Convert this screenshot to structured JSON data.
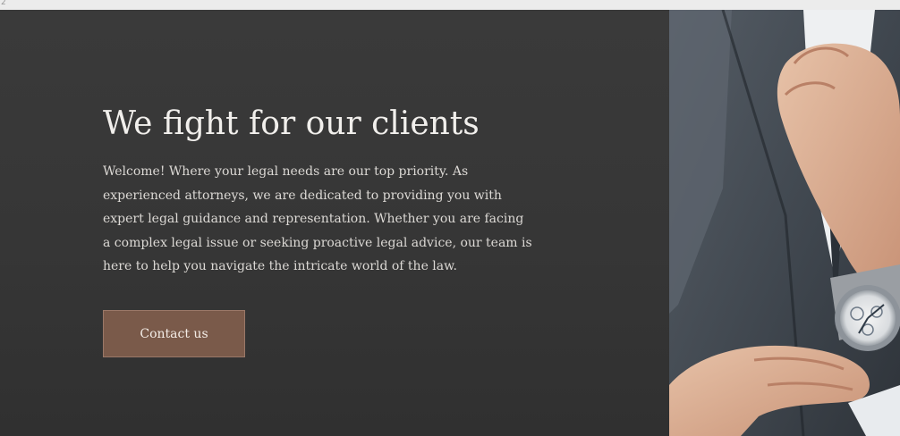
{
  "corner_mark": "2",
  "hero": {
    "headline": "We fight for our clients",
    "body": "Welcome! Where your legal needs are our top priority. As experienced attorneys, we are dedicated to providing you with expert legal guidance and representation. Whether you are facing a complex legal issue or seeking proactive legal advice, our team is here to help you navigate the intricate world of the law.",
    "cta_label": "Contact us"
  },
  "photo": {
    "icon": "man-adjusting-tie-photo"
  },
  "colors": {
    "hero_background": "#363636",
    "headline": "#f1efec",
    "body_text": "#dcd9d5",
    "button": "#7a5a4a",
    "button_text": "#f3ece6"
  }
}
